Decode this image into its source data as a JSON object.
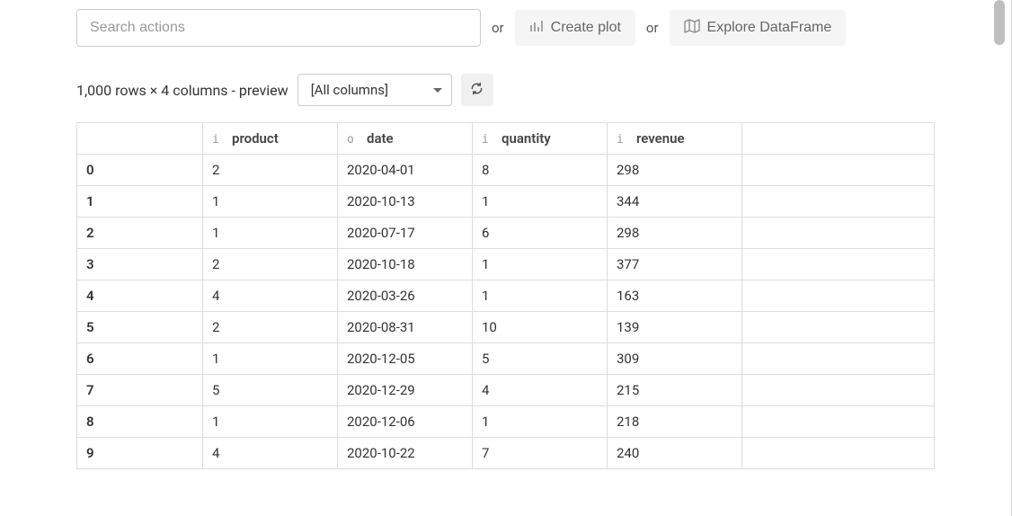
{
  "toolbar": {
    "search_placeholder": "Search actions",
    "or_text": "or",
    "create_plot_label": "Create plot",
    "explore_df_label": "Explore DataFrame"
  },
  "meta": {
    "row_info": "1,000 rows × 4 columns - preview",
    "columns_select": "[All columns]"
  },
  "table": {
    "columns": [
      {
        "type": "i",
        "name": "product"
      },
      {
        "type": "o",
        "name": "date"
      },
      {
        "type": "i",
        "name": "quantity"
      },
      {
        "type": "i",
        "name": "revenue"
      }
    ],
    "rows": [
      {
        "idx": "0",
        "cells": [
          "2",
          "2020-04-01",
          "8",
          "298"
        ]
      },
      {
        "idx": "1",
        "cells": [
          "1",
          "2020-10-13",
          "1",
          "344"
        ]
      },
      {
        "idx": "2",
        "cells": [
          "1",
          "2020-07-17",
          "6",
          "298"
        ]
      },
      {
        "idx": "3",
        "cells": [
          "2",
          "2020-10-18",
          "1",
          "377"
        ]
      },
      {
        "idx": "4",
        "cells": [
          "4",
          "2020-03-26",
          "1",
          "163"
        ]
      },
      {
        "idx": "5",
        "cells": [
          "2",
          "2020-08-31",
          "10",
          "139"
        ]
      },
      {
        "idx": "6",
        "cells": [
          "1",
          "2020-12-05",
          "5",
          "309"
        ]
      },
      {
        "idx": "7",
        "cells": [
          "5",
          "2020-12-29",
          "4",
          "215"
        ]
      },
      {
        "idx": "8",
        "cells": [
          "1",
          "2020-12-06",
          "1",
          "218"
        ]
      },
      {
        "idx": "9",
        "cells": [
          "4",
          "2020-10-22",
          "7",
          "240"
        ]
      }
    ]
  }
}
